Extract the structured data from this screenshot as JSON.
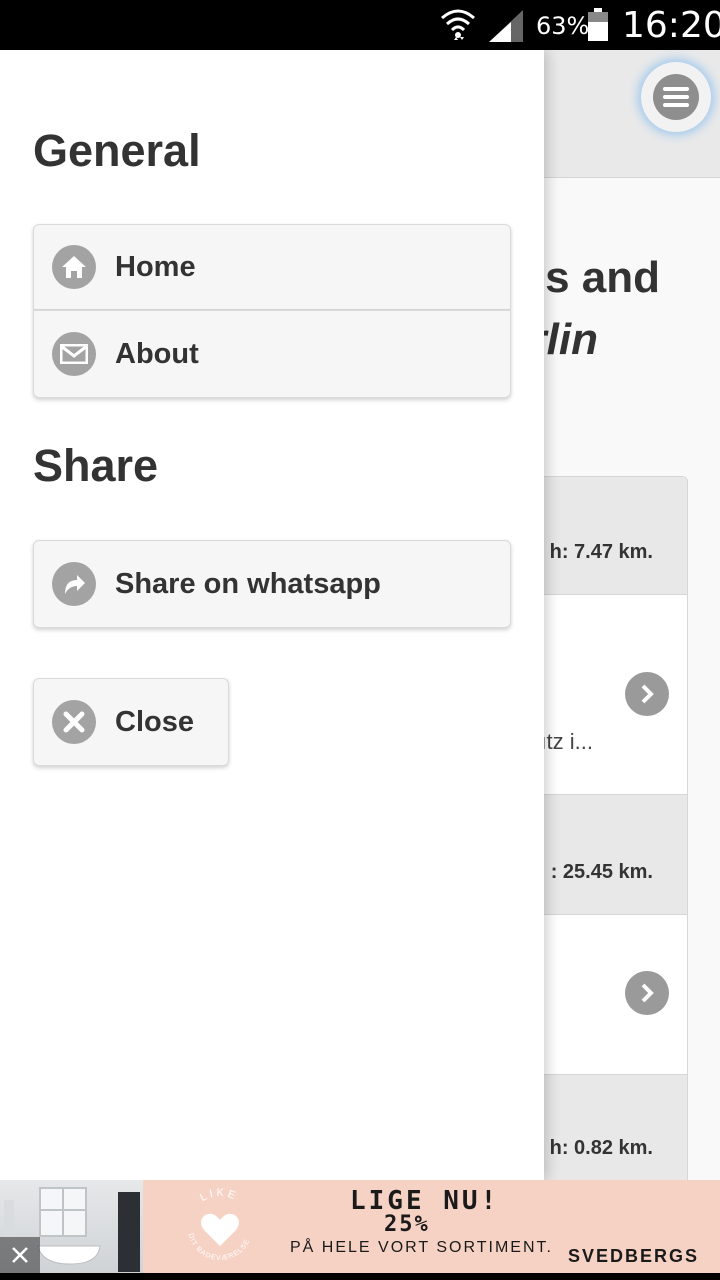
{
  "status_bar": {
    "battery_percent": "63%",
    "time": "16:20"
  },
  "background_page": {
    "title_fragment": "s and",
    "subtitle_fragment": "rlin",
    "list": [
      {
        "kind": "divider",
        "text": "h: 7.47 km."
      },
      {
        "kind": "item",
        "text": "ıtz i..."
      },
      {
        "kind": "divider",
        "text": ": 25.45 km."
      },
      {
        "kind": "item",
        "text": ""
      },
      {
        "kind": "divider",
        "text": "h: 0.82 km."
      }
    ]
  },
  "panel": {
    "general_heading": "General",
    "home_label": "Home",
    "about_label": "About",
    "share_heading": "Share",
    "whatsapp_label": "Share on whatsapp",
    "close_label": "Close"
  },
  "ad": {
    "badge_top": "LIKE",
    "badge_bottom": "DIT BADEVÆRELSE",
    "headline": "LIGE NU!",
    "percent": "25%",
    "line": "PÅ HELE VORT SORTIMENT.",
    "brand": "SVEDBERGS"
  },
  "colors": {
    "icon_gray": "#a3a3a3",
    "button_bg": "#f6f6f6",
    "heading": "#333333",
    "ad_bg": "#f6d2c4"
  }
}
